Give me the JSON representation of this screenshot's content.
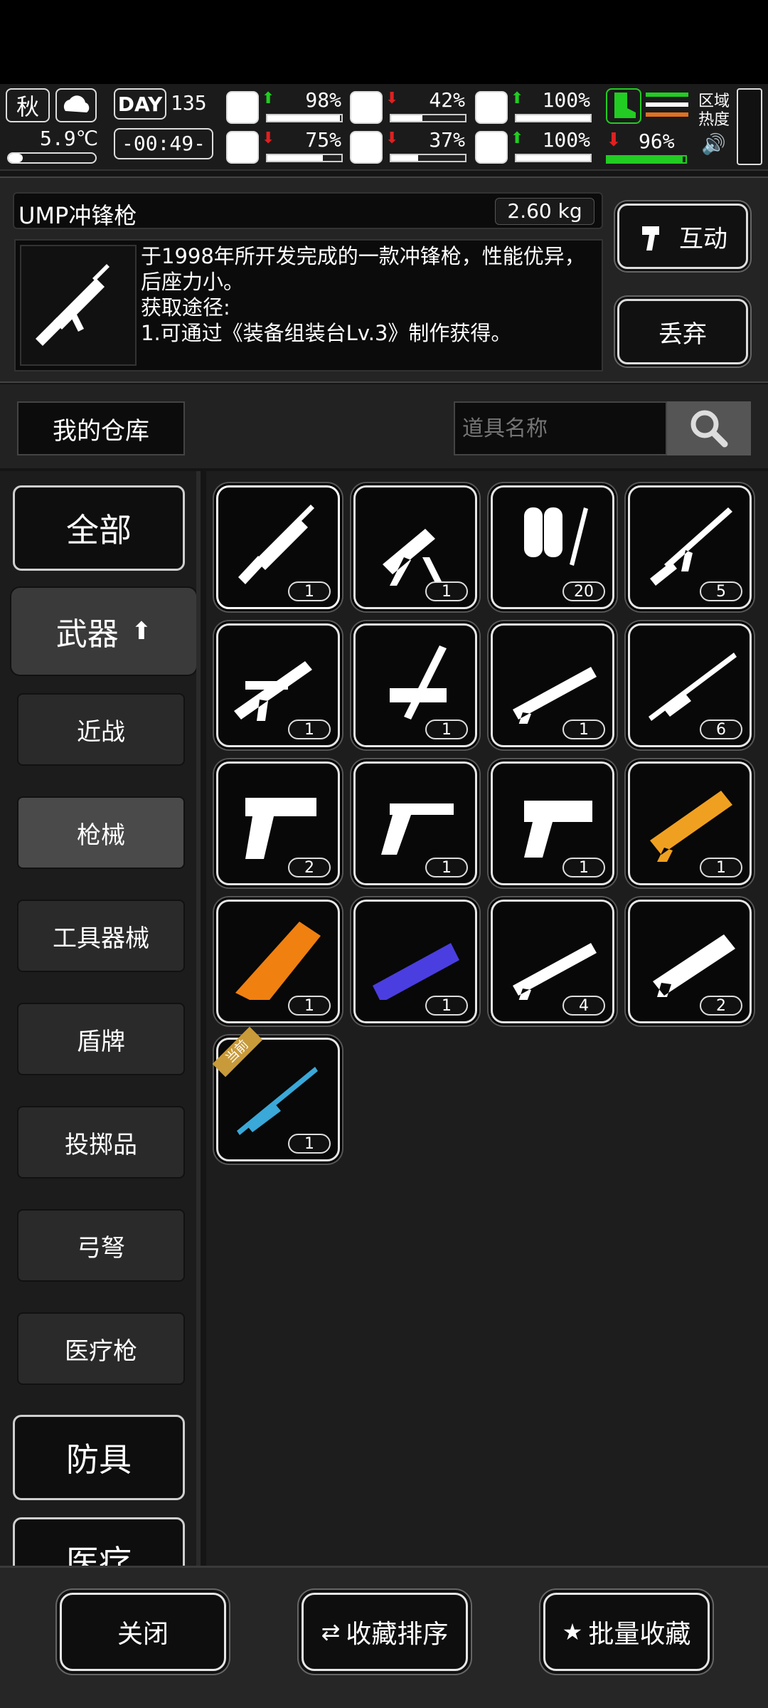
{
  "hud": {
    "season": "秋",
    "temperature": "5.9℃",
    "day_label": "DAY",
    "day_number": "135",
    "clock": "-00:49-",
    "stats_row1": [
      {
        "icon": "medkit-icon",
        "trend": "up",
        "value": "98%",
        "fill": 0.98
      },
      {
        "icon": "stomach-icon",
        "trend": "down",
        "value": "42%",
        "fill": 0.42
      },
      {
        "icon": "helmet-icon",
        "trend": "up",
        "value": "100%",
        "fill": 1.0
      }
    ],
    "stats_row2": [
      {
        "icon": "brain-icon",
        "trend": "down",
        "value": "75%",
        "fill": 0.75
      },
      {
        "icon": "water-drop-icon",
        "trend": "down",
        "value": "37%",
        "fill": 0.37
      },
      {
        "icon": "heart-icon",
        "trend": "up",
        "value": "100%",
        "fill": 1.0
      }
    ],
    "boot_stat": {
      "icon": "boot-icon",
      "trend": "down",
      "value": "96%",
      "fill": 0.96
    },
    "zone_label": "区域热度",
    "colors": {
      "up": "#22cc22",
      "down": "#e02020",
      "boot": "#22cc22",
      "orange": "#e07020"
    }
  },
  "item": {
    "name": "UMP冲锋枪",
    "weight": "2.60 kg",
    "description": "于1998年所开发完成的一款冲锋枪，性能优异，后座力小。",
    "source_label": "获取途径:",
    "source_text": "1.可通过《装备组装台Lv.3》制作获得。",
    "interact_label": "互动",
    "discard_label": "丢弃"
  },
  "warehouse": {
    "title": "我的仓库",
    "search_placeholder": "道具名称"
  },
  "nav": {
    "all": "全部",
    "weapons": "武器",
    "sub": [
      "近战",
      "枪械",
      "工具器械",
      "盾牌",
      "投掷品",
      "弓弩",
      "医疗枪"
    ],
    "selected_sub": "枪械",
    "armor": "防具",
    "medical": "医疗"
  },
  "grid": {
    "current_tag": "当前",
    "items": [
      {
        "name": "smg",
        "count": "1",
        "color": "#ffffff"
      },
      {
        "name": "mounted-gun",
        "count": "1",
        "color": "#ffffff"
      },
      {
        "name": "flamethrower",
        "count": "20",
        "color": "#ffffff"
      },
      {
        "name": "assault-rifle",
        "count": "5",
        "color": "#ffffff"
      },
      {
        "name": "sniper-rifle",
        "count": "1",
        "color": "#ffffff"
      },
      {
        "name": "crossbow-gun",
        "count": "1",
        "color": "#ffffff"
      },
      {
        "name": "shotgun",
        "count": "1",
        "color": "#ffffff"
      },
      {
        "name": "long-rifle",
        "count": "6",
        "color": "#ffffff"
      },
      {
        "name": "pistol",
        "count": "2",
        "color": "#ffffff"
      },
      {
        "name": "revolver",
        "count": "1",
        "color": "#ffffff"
      },
      {
        "name": "heavy-revolver",
        "count": "1",
        "color": "#ffffff"
      },
      {
        "name": "gold-minigun",
        "count": "1",
        "color": "#f0a020"
      },
      {
        "name": "orange-cannon",
        "count": "1",
        "color": "#f08010"
      },
      {
        "name": "blue-blaster",
        "count": "1",
        "color": "#4a3ee0"
      },
      {
        "name": "pump-shotgun",
        "count": "4",
        "color": "#ffffff"
      },
      {
        "name": "minigun",
        "count": "2",
        "color": "#ffffff"
      },
      {
        "name": "teal-sniper",
        "count": "1",
        "color": "#3aa8d8"
      }
    ]
  },
  "bottom": {
    "close": "关闭",
    "sort": "收藏排序",
    "batch": "批量收藏"
  }
}
